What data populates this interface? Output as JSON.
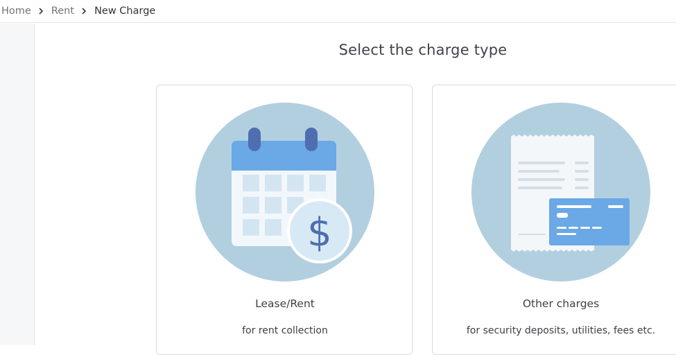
{
  "breadcrumb": {
    "items": [
      "Home",
      "Rent",
      "New Charge"
    ]
  },
  "page": {
    "title": "Select the charge type"
  },
  "cards": [
    {
      "title": "Lease/Rent",
      "description": "for rent collection",
      "icon": "calendar-dollar-icon"
    },
    {
      "title": "Other charges",
      "description": "for security deposits, utilities, fees etc.",
      "icon": "receipt-card-icon"
    }
  ],
  "colors": {
    "circle_bg": "#b2cfe0",
    "calendar_header": "#6aa8e6",
    "calendar_ring": "#4f6eb0",
    "card_blue": "#6aa8e6",
    "dollar": "#4f6eb0"
  }
}
